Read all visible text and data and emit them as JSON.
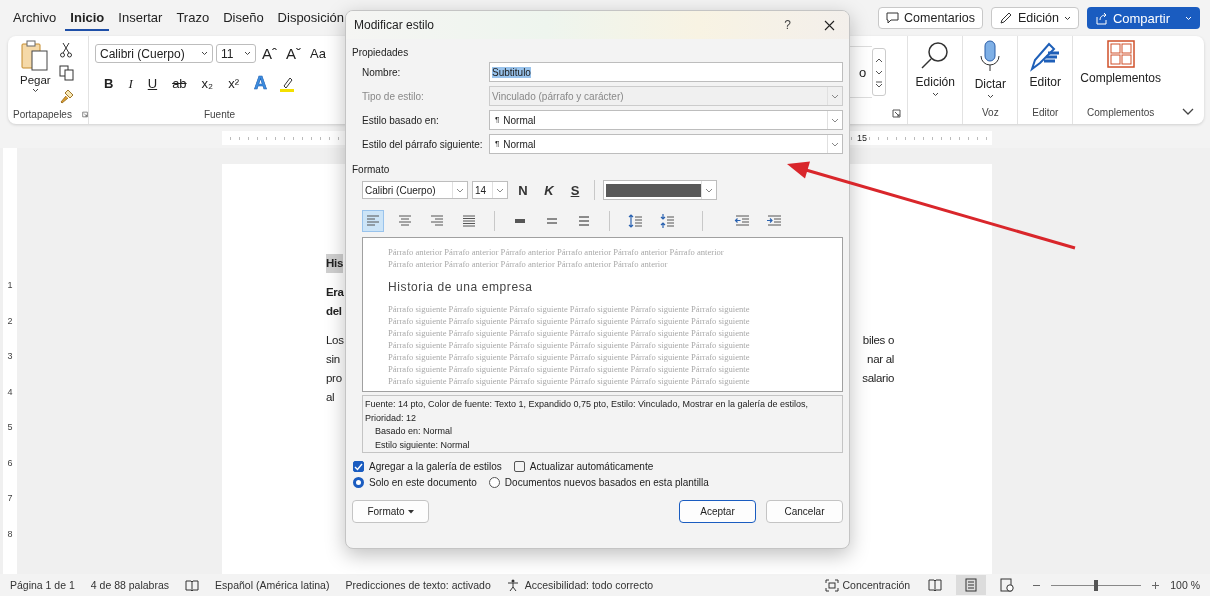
{
  "app_tabs": [
    {
      "label": "Archivo",
      "selected": false
    },
    {
      "label": "Inicio",
      "selected": true
    },
    {
      "label": "Insertar",
      "selected": false
    },
    {
      "label": "Trazo",
      "selected": false
    },
    {
      "label": "Diseño",
      "selected": false
    },
    {
      "label": "Disposición",
      "selected": false
    }
  ],
  "top_buttons": [
    {
      "kind": "comments",
      "label": "Comentarios"
    },
    {
      "kind": "edit",
      "label": "Edición"
    },
    {
      "kind": "share",
      "label": "Compartir"
    }
  ],
  "ribbon": {
    "clipboard": {
      "paste": "Pegar",
      "group": "Portapapeles"
    },
    "font": {
      "family": "Calibri (Cuerpo)",
      "size": "11",
      "grow": "Aˆ",
      "shrink": "Aˇ",
      "case": "Aa",
      "buttons": [
        {
          "label": "B",
          "kind": "bold"
        },
        {
          "label": "I",
          "kind": "italic"
        },
        {
          "label": "U",
          "kind": "underline"
        },
        {
          "label": "ab",
          "kind": "strike"
        },
        {
          "label": "x₂",
          "kind": "plain"
        },
        {
          "label": "x²",
          "kind": "plain"
        }
      ],
      "effects": "A",
      "group": "Fuente"
    },
    "styles_fragment": "o",
    "groups": [
      {
        "kind": "find",
        "label": "Edición",
        "caret": true
      },
      {
        "kind": "dictate",
        "label": "Dictar",
        "caret": true,
        "group": "Voz"
      },
      {
        "kind": "editor",
        "label": "Editor",
        "caret": false,
        "group": "Editor"
      },
      {
        "kind": "addins",
        "label": "Complementos",
        "caret": false,
        "group": "Complementos"
      }
    ]
  },
  "ruler": {
    "horizontal_label": "15",
    "vertical_labels": [
      "1",
      "2",
      "3",
      "4",
      "5",
      "6",
      "7",
      "8"
    ]
  },
  "document": {
    "paragraphs": [
      {
        "bold": true,
        "lines": [
          {
            "left": "His",
            "highlighted": true
          }
        ]
      },
      {
        "bold": true,
        "lines": [
          {
            "left": "Era",
            "highlighted": false
          },
          {
            "left": "del",
            "highlighted": false
          }
        ]
      },
      {
        "bold": false,
        "lines": [
          {
            "left": "Los",
            "right": "biles o",
            "highlighted": false
          },
          {
            "left": "sin",
            "right": "nar al",
            "highlighted": false
          },
          {
            "left": "pro",
            "right": "salario",
            "highlighted": false
          },
          {
            "left": "al",
            "highlighted": false
          }
        ]
      }
    ]
  },
  "dialog": {
    "title": "Modificar estilo",
    "help": "?",
    "properties_heading": "Propiedades",
    "fields": [
      {
        "kind": "text",
        "label": "Nombre:",
        "value": "Subtitulo",
        "value_selected": true,
        "disabled": false
      },
      {
        "kind": "select",
        "label": "Tipo de estilo:",
        "value": "Vinculado (párrafo y carácter)",
        "value_selected": false,
        "disabled": true
      },
      {
        "kind": "select",
        "label": "Estilo basado en:",
        "mark": "¶",
        "value": "Normal",
        "value_selected": false,
        "disabled": false
      },
      {
        "kind": "select",
        "label": "Estilo del párrafo siguiente:",
        "mark": "¶",
        "value": "Normal",
        "value_selected": false,
        "disabled": false
      }
    ],
    "format": {
      "heading": "Formato",
      "font": "Calibri (Cuerpo)",
      "size": "14",
      "styles": [
        {
          "label": "N",
          "kind": "bold"
        },
        {
          "label": "K",
          "kind": "italic"
        },
        {
          "label": "S",
          "kind": "underline"
        }
      ],
      "paragraph_buttons": [
        {
          "kind": "left",
          "selected": true
        },
        {
          "kind": "center",
          "selected": false
        },
        {
          "kind": "right",
          "selected": false
        },
        {
          "kind": "justify",
          "selected": false
        },
        {
          "kind": "single",
          "selected": false
        },
        {
          "kind": "onehalf",
          "selected": false
        },
        {
          "kind": "double",
          "selected": false
        },
        {
          "kind": "space-more",
          "selected": false
        },
        {
          "kind": "space-less",
          "selected": false
        },
        {
          "kind": "indent-less",
          "selected": false
        },
        {
          "kind": "indent-more",
          "selected": false
        }
      ]
    },
    "preview": {
      "before": [
        "Párrafo anterior Párrafo anterior Párrafo anterior Párrafo anterior Párrafo anterior Párrafo anterior",
        "Párrafo anterior Párrafo anterior Párrafo anterior Párrafo anterior Párrafo anterior"
      ],
      "sample": "Historia de una empresa",
      "after": [
        "Párrafo siguiente Párrafo siguiente Párrafo siguiente Párrafo siguiente Párrafo siguiente Párrafo siguiente",
        "Párrafo siguiente Párrafo siguiente Párrafo siguiente Párrafo siguiente Párrafo siguiente Párrafo siguiente",
        "Párrafo siguiente Párrafo siguiente Párrafo siguiente Párrafo siguiente Párrafo siguiente Párrafo siguiente",
        "Párrafo siguiente Párrafo siguiente Párrafo siguiente Párrafo siguiente Párrafo siguiente Párrafo siguiente",
        "Párrafo siguiente Párrafo siguiente Párrafo siguiente Párrafo siguiente Párrafo siguiente Párrafo siguiente",
        "Párrafo siguiente Párrafo siguiente Párrafo siguiente Párrafo siguiente Párrafo siguiente Párrafo siguiente",
        "Párrafo siguiente Párrafo siguiente Párrafo siguiente Párrafo siguiente Párrafo siguiente Párrafo siguiente"
      ]
    },
    "description": {
      "text": "Fuente: 14 pto, Color de fuente: Texto 1, Expandido  0,75 pto, Estilo: Vinculado, Mostrar en la galería de estilos, Prioridad: 12",
      "details": [
        "Basado en: Normal",
        "Estilo siguiente: Normal"
      ]
    },
    "options": [
      {
        "label": "Agregar a la galería de estilos",
        "checked": true
      },
      {
        "label": "Actualizar automáticamente",
        "checked": false
      }
    ],
    "scope": [
      {
        "label": "Solo en este documento",
        "selected": true
      },
      {
        "label": "Documentos nuevos basados en esta plantilla",
        "selected": false
      }
    ],
    "buttons": [
      {
        "kind": "menu",
        "label": "Formato"
      },
      {
        "kind": "default",
        "label": "Aceptar"
      },
      {
        "kind": "normal",
        "label": "Cancelar"
      }
    ]
  },
  "status_bar": {
    "left": [
      {
        "kind": "text",
        "label": "Página 1 de 1"
      },
      {
        "kind": "text",
        "label": "4 de 88 palabras"
      },
      {
        "kind": "proofing"
      },
      {
        "kind": "text",
        "label": "Español (América latina)"
      },
      {
        "kind": "text",
        "label": "Predicciones de texto: activado"
      },
      {
        "kind": "accessibility",
        "label": "Accesibilidad: todo correcto"
      }
    ],
    "focus": "Concentración",
    "views": [
      {
        "kind": "read",
        "selected": false
      },
      {
        "kind": "print",
        "selected": true
      },
      {
        "kind": "web",
        "selected": false
      }
    ],
    "zoom": {
      "level": 0.5,
      "reading": "100 %"
    }
  }
}
